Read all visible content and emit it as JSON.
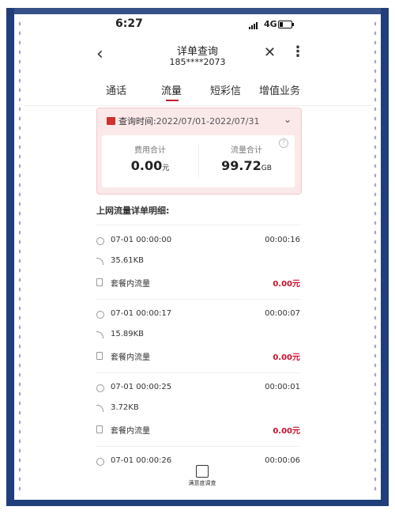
{
  "status_bar": {
    "time": "6:27",
    "network": "4G"
  },
  "header": {
    "title": "详单查询",
    "phone": "185****2073",
    "back_icon": "chevron-left-icon",
    "close_icon": "close-icon",
    "more_icon": "more-vertical-icon"
  },
  "tabs": [
    {
      "label": "通话"
    },
    {
      "label": "流量",
      "active": true
    },
    {
      "label": "短彩信"
    },
    {
      "label": "增值业务"
    }
  ],
  "summary": {
    "query_label": "查询时间:",
    "date_range": "2022/07/01-2022/07/31",
    "fee_label": "费用合计",
    "fee_value": "0.00",
    "fee_unit": "元",
    "data_label": "流量合计",
    "data_value": "99.72",
    "data_unit": "GB"
  },
  "section_title": "上网流量详单明细:",
  "records": [
    {
      "time": "07-01 00:00:00",
      "duration": "00:00:16",
      "size": "35.61KB",
      "type": "套餐内流量",
      "fee": "0.00元"
    },
    {
      "time": "07-01 00:00:17",
      "duration": "00:00:07",
      "size": "15.89KB",
      "type": "套餐内流量",
      "fee": "0.00元"
    },
    {
      "time": "07-01 00:00:25",
      "duration": "00:00:01",
      "size": "3.72KB",
      "type": "套餐内流量",
      "fee": "0.00元"
    },
    {
      "time": "07-01 00:00:26",
      "duration": "00:00:06"
    }
  ],
  "bottom_badge": {
    "label": "满意度调查"
  },
  "colors": {
    "accent": "#c8102e",
    "card_bg": "#fbe9ea",
    "frame": "#1f3e7a"
  }
}
